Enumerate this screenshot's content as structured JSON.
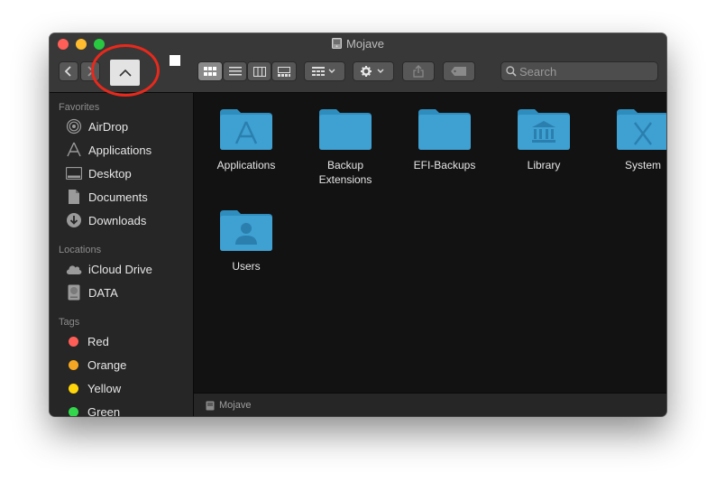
{
  "window": {
    "title": "Mojave"
  },
  "toolbar": {
    "search_placeholder": "Search"
  },
  "sidebar": {
    "favorites_heading": "Favorites",
    "favorites": [
      {
        "label": "AirDrop",
        "icon": "airdrop-icon"
      },
      {
        "label": "Applications",
        "icon": "applications-icon"
      },
      {
        "label": "Desktop",
        "icon": "desktop-icon"
      },
      {
        "label": "Documents",
        "icon": "document-icon"
      },
      {
        "label": "Downloads",
        "icon": "download-icon"
      }
    ],
    "locations_heading": "Locations",
    "locations": [
      {
        "label": "iCloud Drive",
        "icon": "cloud-icon"
      },
      {
        "label": "DATA",
        "icon": "disk-icon"
      }
    ],
    "tags_heading": "Tags",
    "tags": [
      {
        "label": "Red",
        "color": "#ff5e57"
      },
      {
        "label": "Orange",
        "color": "#f5a623"
      },
      {
        "label": "Yellow",
        "color": "#ffd60a"
      },
      {
        "label": "Green",
        "color": "#32d74b"
      }
    ]
  },
  "content": {
    "folders": [
      {
        "label": "Applications",
        "glyph": "app-store-a-icon"
      },
      {
        "label": "Backup Extensions",
        "glyph": "none"
      },
      {
        "label": "EFI-Backups",
        "glyph": "none"
      },
      {
        "label": "Library",
        "glyph": "library-building-icon"
      },
      {
        "label": "System",
        "glyph": "x-icon"
      },
      {
        "label": "Users",
        "glyph": "user-silhouette-icon"
      }
    ]
  },
  "pathbar": {
    "label": "Mojave"
  },
  "colors": {
    "folder": "#3fa0d2",
    "folder_tab": "#2f8dbd",
    "annotation": "#e8291c"
  }
}
